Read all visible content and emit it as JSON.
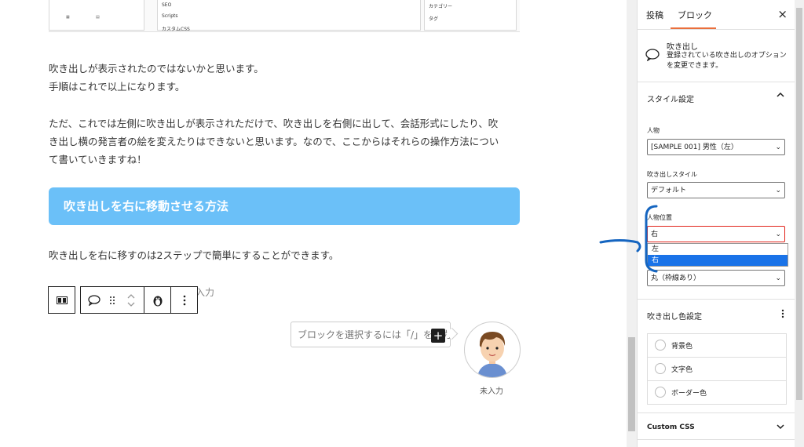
{
  "top_screenshot": {
    "scripts_label": "Scripts",
    "tag_label": "タグ",
    "category_label": "カテゴリー",
    "seo_label": "SEO",
    "css_label": "カスタムCSS"
  },
  "content": {
    "paragraph1_line1": "吹き出しが表示されたのではないかと思います。",
    "paragraph1_line2": "手順はこれで以上になります。",
    "paragraph2_line1": "ただ、これでは左側に吹き出しが表示されただけで、吹き出しを右側に出して、会話形式にしたり、吹",
    "paragraph2_line2": "き出し横の発言者の絵を変えたりはできないと思います。なので、ここからはそれらの操作方法につい",
    "paragraph2_line3": "て書いていきますね！",
    "heading": "吹き出しを右に移動させる方法",
    "paragraph3": "吹き出しを右に移すのは2ステップで簡単にすることができます。",
    "ghost_text": "入力",
    "bubble_placeholder": "ブロックを選択するには「/」を入力",
    "plus_label": "+",
    "avatar_name": "未入力"
  },
  "toolbar": {
    "block_type_icon": "columns-icon",
    "bubble_icon": "speech-bubble-icon",
    "drag_icon": "drag-handle-icon",
    "move_icon": "up-down-chevron-icon",
    "penguin_icon": "penguin-icon",
    "more_icon": "vertical-ellipsis-icon"
  },
  "sidebar": {
    "tab_post": "投稿",
    "tab_block": "ブロック",
    "close": "×",
    "block_title": "吹き出し",
    "block_desc": "登録されている吹き出しのオプションを変更できます。",
    "style_panel": "スタイル設定",
    "person_label": "人物",
    "person_value": "[SAMPLE 001] 男性（左）",
    "balloon_style_label": "吹き出しスタイル",
    "balloon_style_value": "デフォルト",
    "position_label": "人物位置",
    "position_value": "右",
    "position_options": [
      "左",
      "右"
    ],
    "frame_value": "丸（枠線あり）",
    "color_panel": "吹き出し色設定",
    "colors": [
      "背景色",
      "文字色",
      "ボーダー色"
    ],
    "custom_css": "Custom CSS",
    "accent_color": "#ea6f3c"
  },
  "colors": {
    "heading_bg": "#6bc0f8",
    "annotation": "#1565c0",
    "focus": "#e2231a",
    "selected_option": "#1a73e8"
  }
}
